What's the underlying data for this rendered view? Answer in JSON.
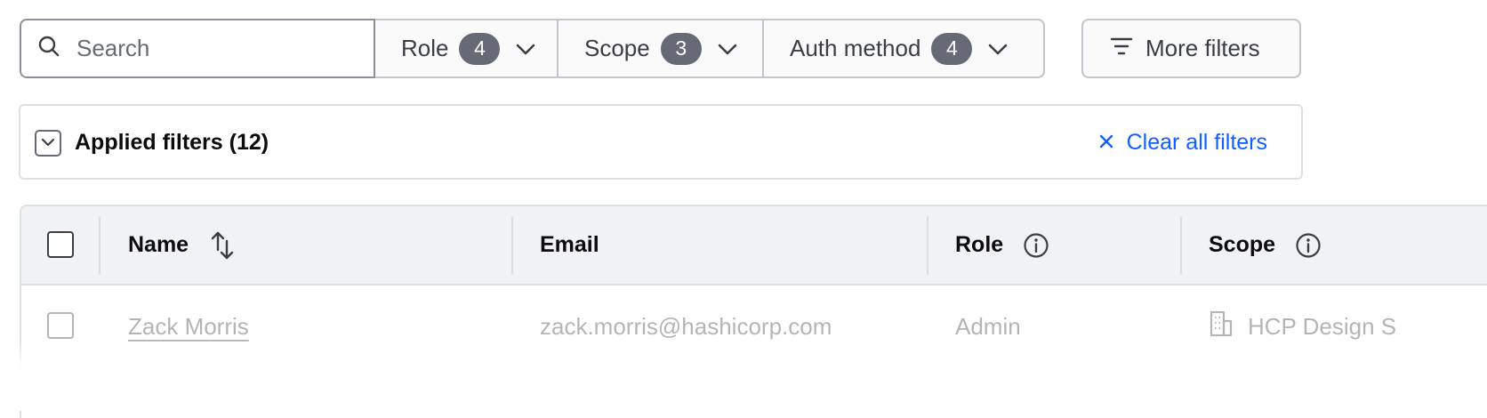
{
  "filters": {
    "search_placeholder": "Search",
    "role": {
      "label": "Role",
      "count": "4"
    },
    "scope": {
      "label": "Scope",
      "count": "3"
    },
    "auth_method": {
      "label": "Auth method",
      "count": "4"
    },
    "more_filters_label": "More filters"
  },
  "applied_filters": {
    "title": "Applied filters (12)",
    "clear_label": "Clear all filters"
  },
  "table": {
    "columns": {
      "name": "Name",
      "email": "Email",
      "role": "Role",
      "scope": "Scope"
    },
    "rows": [
      {
        "name": "Zack Morris",
        "email": "zack.morris@hashicorp.com",
        "role": "Admin",
        "scope": "HCP Design S"
      }
    ]
  },
  "colors": {
    "accent_link": "#1060ff",
    "badge_bg": "#656a76",
    "header_bg": "#f1f2f3"
  },
  "icons": [
    "search-icon",
    "chevron-down-icon",
    "filter-lines-icon",
    "close-icon",
    "sort-icon",
    "info-icon",
    "building-icon"
  ]
}
